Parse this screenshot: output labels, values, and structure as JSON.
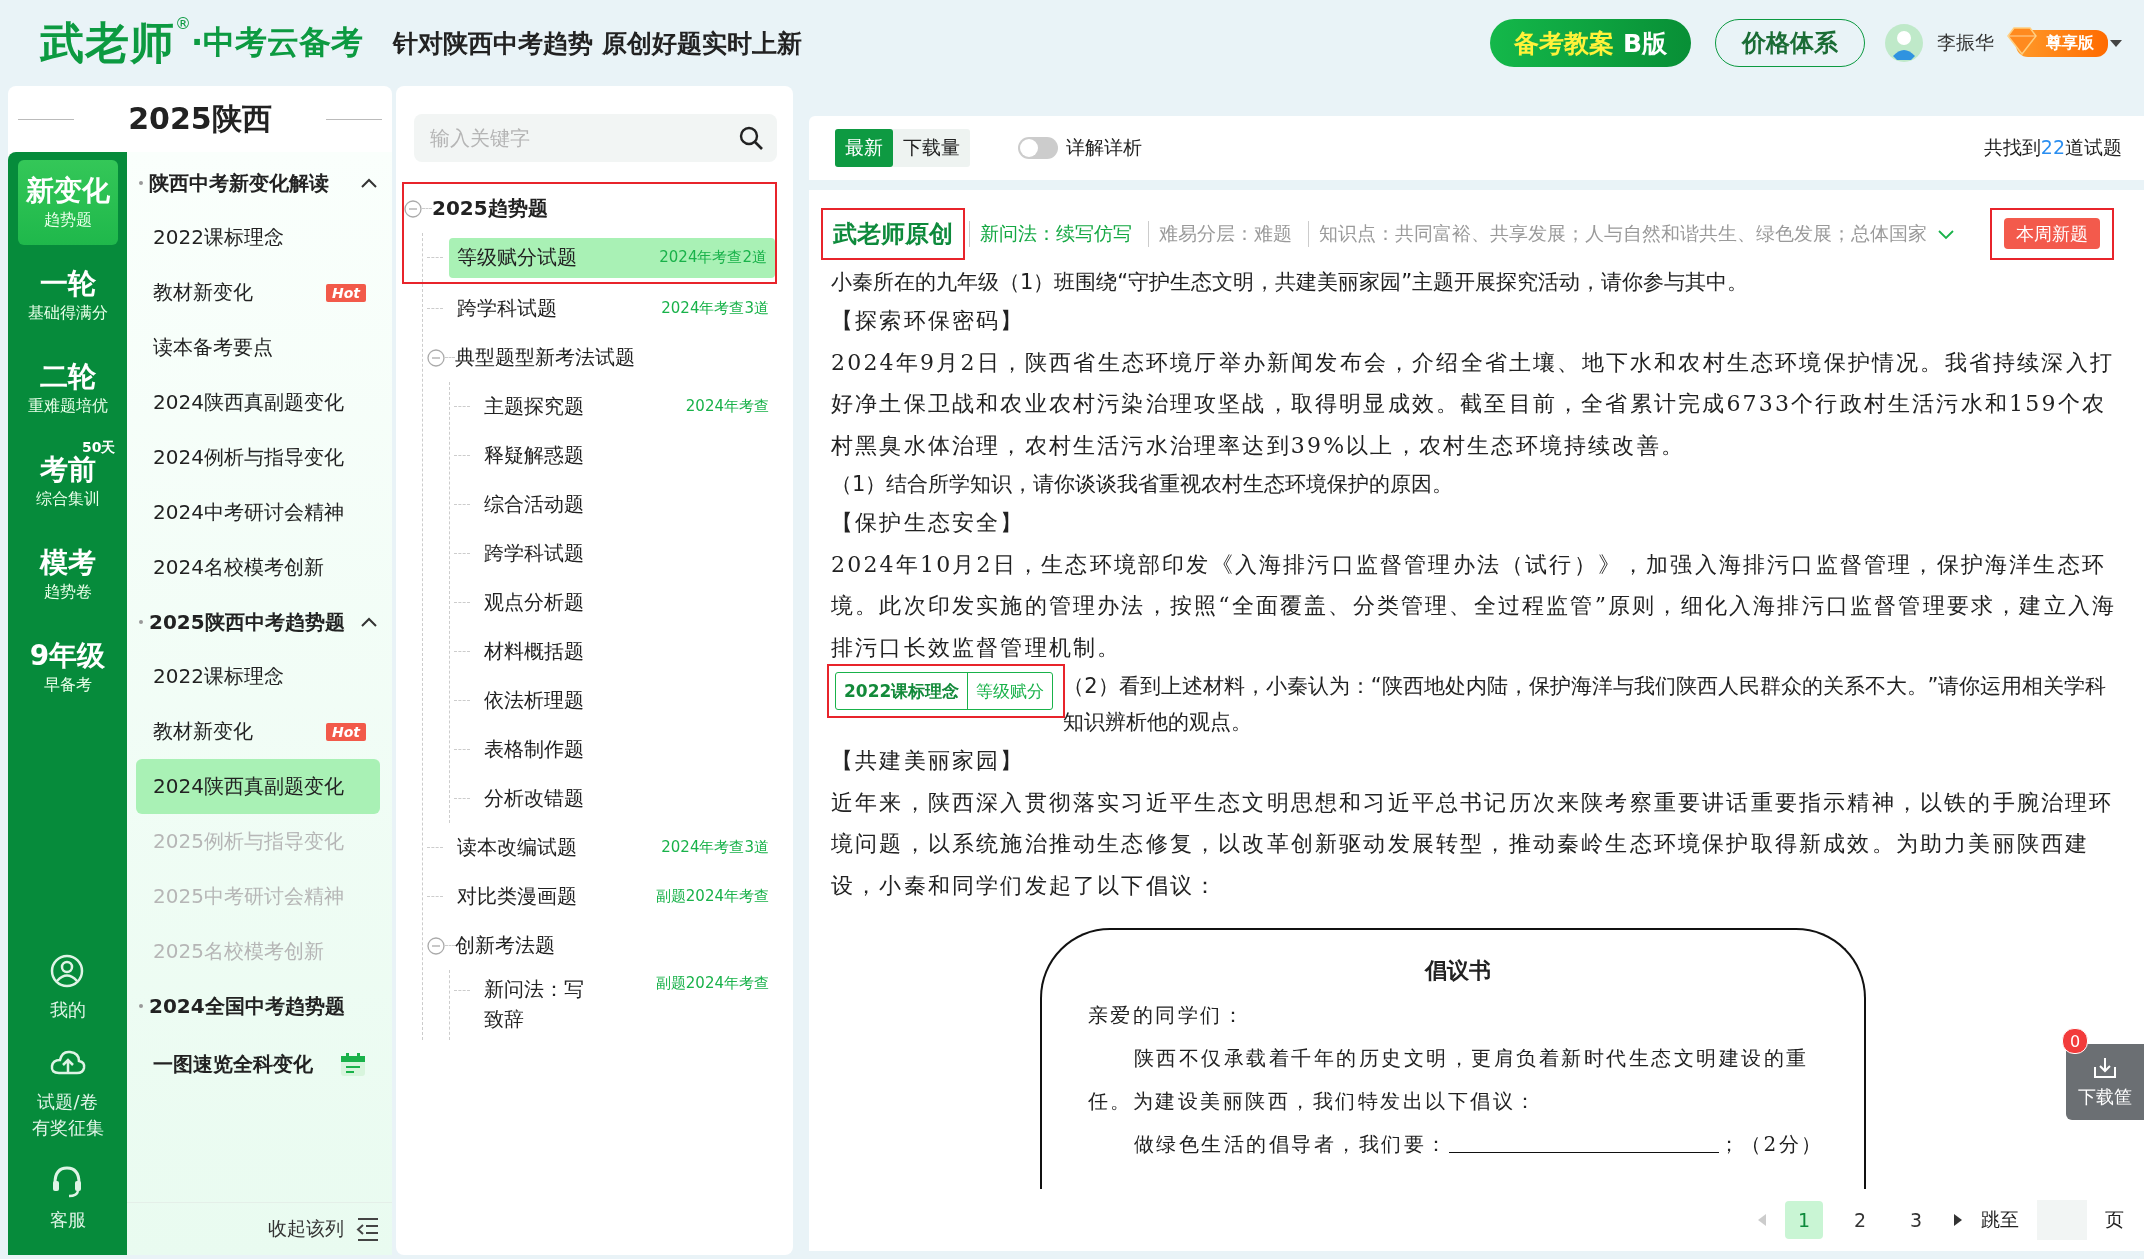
{
  "header": {
    "logo": "武老师",
    "logo_mark": "®",
    "product": "·中考云备考",
    "tagline": "针对陕西中考趋势 原创好题实时上新",
    "plan_button": {
      "label": "备考教案",
      "suffix": "B版"
    },
    "price_button": "价格体系",
    "user": "李振华",
    "vip_badge": "尊享版"
  },
  "rail": {
    "items": [
      {
        "title": "新变化",
        "subtitle": "趋势题",
        "selected": true
      },
      {
        "title": "一轮",
        "subtitle": "基础得满分",
        "selected": false
      },
      {
        "title": "二轮",
        "subtitle": "重难题培优",
        "selected": false
      },
      {
        "title": "考前",
        "subtitle": "综合集训",
        "note": "50天",
        "selected": false
      },
      {
        "title": "模考",
        "subtitle": "趋势卷",
        "selected": false
      },
      {
        "title": "9年级",
        "subtitle": "早备考",
        "selected": false
      }
    ],
    "links": [
      {
        "kind": "user",
        "lines": [
          "我的"
        ]
      },
      {
        "kind": "upload",
        "lines": [
          "试题/卷",
          "有奖征集"
        ]
      },
      {
        "kind": "service",
        "lines": [
          "客服"
        ]
      }
    ]
  },
  "nav": {
    "title": "2025陕西",
    "groups": [
      {
        "label": "陕西中考新变化解读",
        "expanded": true,
        "items": [
          {
            "label": "2022课标理念",
            "selected": false,
            "disabled": false
          },
          {
            "label": "教材新变化",
            "selected": false,
            "disabled": false,
            "badge": "Hot"
          },
          {
            "label": "读本备考要点",
            "selected": false,
            "disabled": false
          },
          {
            "label": "2024陕西真副题变化",
            "selected": false,
            "disabled": false
          },
          {
            "label": "2024例析与指导变化",
            "selected": false,
            "disabled": false
          },
          {
            "label": "2024中考研讨会精神",
            "selected": false,
            "disabled": false
          },
          {
            "label": "2024名校模考创新",
            "selected": false,
            "disabled": false
          }
        ]
      },
      {
        "label": "2025陕西中考趋势题",
        "expanded": true,
        "items": [
          {
            "label": "2022课标理念",
            "selected": false,
            "disabled": false
          },
          {
            "label": "教材新变化",
            "selected": false,
            "disabled": false,
            "badge": "Hot"
          },
          {
            "label": "2024陕西真副题变化",
            "selected": true,
            "disabled": false
          },
          {
            "label": "2025例析与指导变化",
            "selected": false,
            "disabled": true
          },
          {
            "label": "2025中考研讨会精神",
            "selected": false,
            "disabled": true
          },
          {
            "label": "2025名校模考创新",
            "selected": false,
            "disabled": true
          }
        ]
      },
      {
        "label": "2024全国中考趋势题"
      }
    ],
    "feature": "一图速览全科变化",
    "collapse": "收起该列"
  },
  "tree": {
    "search_placeholder": "输入关键字",
    "nodes": [
      {
        "label": "2025趋势题",
        "expanded": true,
        "annotated": true,
        "children": [
          {
            "label": "等级赋分试题",
            "selected": true,
            "tag": "2024年考查2道"
          },
          {
            "label": "跨学科试题",
            "selected": false,
            "tag": "2024年考查3道"
          },
          {
            "label": "典型题型新考法试题",
            "expanded": true,
            "children": [
              {
                "label": "主题探究题",
                "selected": false,
                "tag": "2024年考查"
              },
              {
                "label": "释疑解惑题",
                "selected": false
              },
              {
                "label": "综合活动题",
                "selected": false
              },
              {
                "label": "跨学科试题",
                "selected": false
              },
              {
                "label": "观点分析题",
                "selected": false
              },
              {
                "label": "材料概括题",
                "selected": false
              },
              {
                "label": "依法析理题",
                "selected": false
              },
              {
                "label": "表格制作题",
                "selected": false
              },
              {
                "label": "分析改错题",
                "selected": false
              }
            ]
          },
          {
            "label": "读本改编试题",
            "selected": false,
            "tag": "2024年考查3道"
          },
          {
            "label": "对比类漫画题",
            "selected": false,
            "tag": "副题2024年考查"
          },
          {
            "label": "创新考法题",
            "expanded": true,
            "children": [
              {
                "label": "新问法：写致辞",
                "selected": false,
                "tag": "副题2024年考查"
              }
            ]
          }
        ]
      }
    ]
  },
  "main": {
    "sort_tabs": [
      {
        "label": "最新",
        "selected": true
      },
      {
        "label": "下载量",
        "selected": false
      }
    ],
    "detail_toggle": {
      "label": "详解详析",
      "on": false
    },
    "result": {
      "prefix": "共找到",
      "count": "22",
      "suffix": "道试题"
    },
    "question": {
      "source": "武老师原创",
      "source_annotated": true,
      "meta": [
        {
          "kind": "highlight",
          "text": "新问法：续写仿写"
        },
        {
          "kind": "plain",
          "text": "难易分层：难题"
        },
        {
          "kind": "plain",
          "text": "知识点：共同富裕、共享发展；人与自然和谐共生、绿色发展；总体国家"
        }
      ],
      "badge": "本周新题",
      "badge_annotated": true,
      "paragraphs": [
        {
          "kind": "intro",
          "text": "小秦所在的九年级（1）班围绕“守护生态文明，共建美丽家园”主题开展探究活动，请你参与其中。"
        },
        {
          "kind": "heading",
          "text": "【探索环保密码】"
        },
        {
          "kind": "body",
          "text": "2024年9月2日，陕西省生态环境厅举办新闻发布会，介绍全省土壤、地下水和农村生态环境保护情况。我省持续深入打好净土保卫战和农业农村污染治理攻坚战，取得明显成效。截至目前，全省累计完成6733个行政村生活污水和159个农村黑臭水体治理，农村生活污水治理率达到39%以上，农村生态环境持续改善。"
        },
        {
          "kind": "question",
          "text": "（1）结合所学知识，请你谈谈我省重视农村生态环境保护的原因。"
        },
        {
          "kind": "heading",
          "text": "【保护生态安全】"
        },
        {
          "kind": "body",
          "text": "2024年10月2日，生态环境部印发《入海排污口监督管理办法（试行）》，加强入海排污口监督管理，保护海洋生态环境。此次印发实施的管理办法，按照“全面覆盖、分类管理、全过程监管”原则，细化入海排污口监督管理要求，建立入海排污口长效监督管理机制。"
        },
        {
          "kind": "question",
          "tags": [
            "2022课标理念",
            "等级赋分"
          ],
          "tags_annotated": true,
          "text": "（2）看到上述材料，小秦认为：“陕西地处内陆，保护海洋与我们陕西人民群众的关系不大。”请你运用相关学科知识辨析他的观点。"
        },
        {
          "kind": "heading",
          "text": "【共建美丽家园】"
        },
        {
          "kind": "body",
          "text": "近年来，陕西深入贯彻落实习近平生态文明思想和习近平总书记历次来陕考察重要讲话重要指示精神，以铁的手腕治理环境问题，以系统施治推动生态修复，以改革创新驱动发展转型，推动秦岭生态环境保护取得新成效。为助力美丽陕西建设，小秦和同学们发起了以下倡议："
        }
      ],
      "figure": {
        "title": "倡议书",
        "lines": [
          {
            "kind": "salutation",
            "text": "亲爱的同学们："
          },
          {
            "kind": "indent",
            "text": "陕西不仅承载着千年的历史文明，更肩负着新时代生态文明建设的重任。为建设美丽陕西，我们特发出以下倡议："
          },
          {
            "kind": "blank",
            "text": "做绿色生活的倡导者，我们要：",
            "after": "；（2分）"
          }
        ]
      }
    },
    "pagination": {
      "prev_disabled": true,
      "pages": [
        {
          "label": "1",
          "selected": true
        },
        {
          "label": "2",
          "selected": false
        },
        {
          "label": "3",
          "selected": false
        }
      ],
      "jump_label": "跳至",
      "unit": "页"
    },
    "basket": {
      "label": "下载筐",
      "count": "0"
    }
  }
}
